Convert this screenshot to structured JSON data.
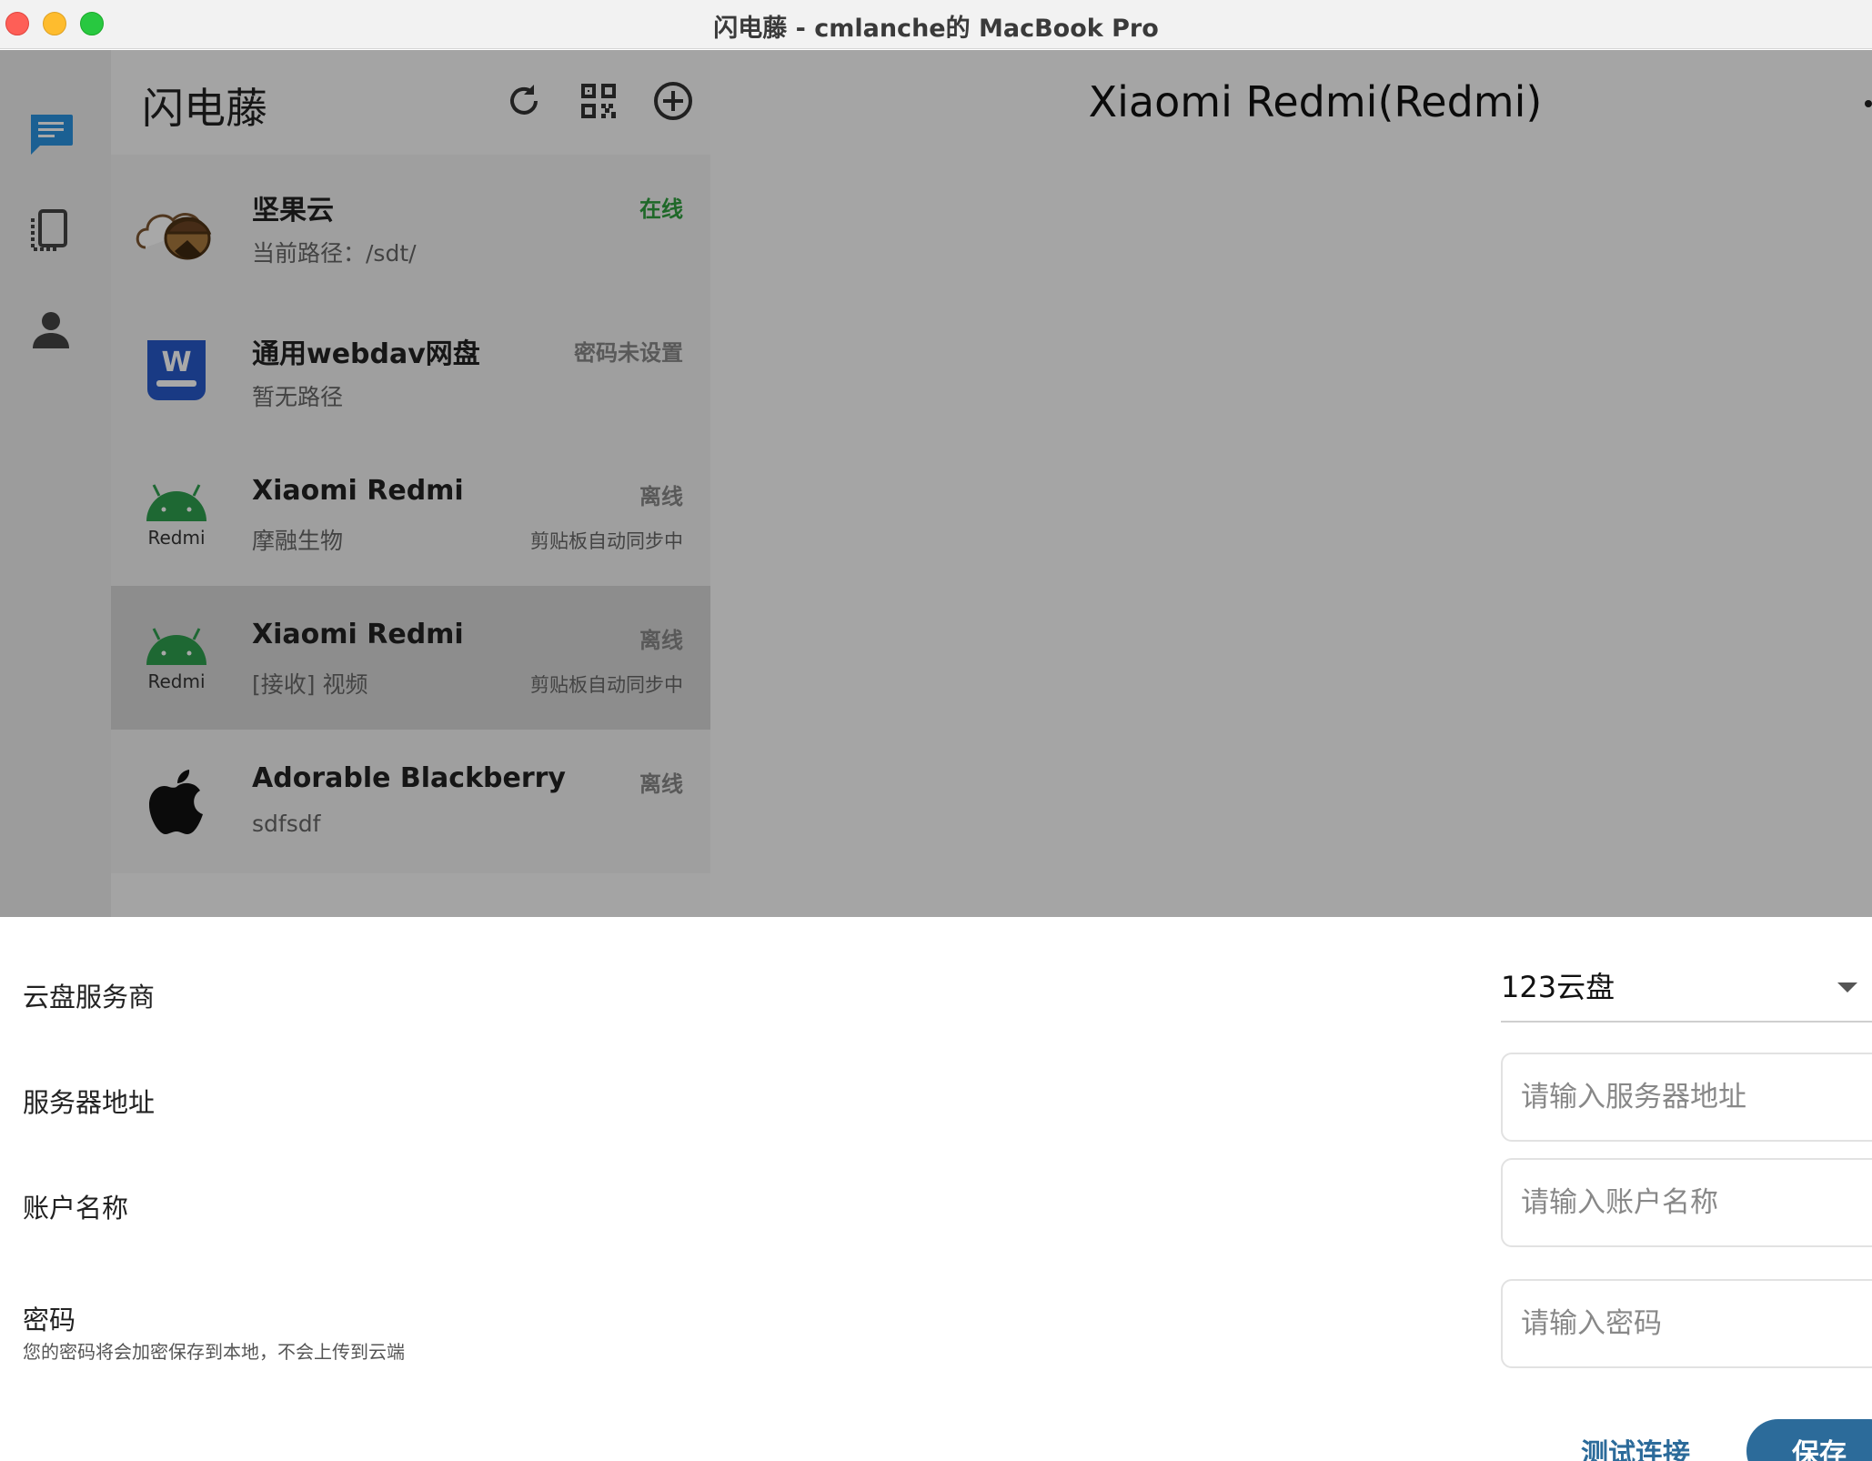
{
  "window": {
    "title": "闪电藤 - cmlanche的 MacBook Pro"
  },
  "rail": {
    "icons": [
      "chat-icon",
      "devices-icon",
      "person-icon"
    ]
  },
  "header": {
    "app_name": "闪电藤",
    "buttons": [
      "refresh-icon",
      "qrcode-icon",
      "add-icon"
    ]
  },
  "devices": [
    {
      "name": "坚果云",
      "desc": "当前路径：/sdt/",
      "status": "在线",
      "status_kind": "online",
      "icon": "jianguoyun-logo-icon",
      "icon_sub": "",
      "sync": ""
    },
    {
      "name": "通用webdav网盘",
      "desc": "暂无路径",
      "status": "密码未设置",
      "status_kind": "neutral",
      "icon": "webdav-logo-icon",
      "icon_sub": "",
      "sync": ""
    },
    {
      "name": "Xiaomi Redmi",
      "desc": "摩融生物",
      "status": "离线",
      "status_kind": "offline",
      "icon": "android-icon",
      "icon_sub": "Redmi",
      "sync": "剪贴板自动同步中"
    },
    {
      "name": "Xiaomi Redmi",
      "desc": "[接收] 视频",
      "status": "离线",
      "status_kind": "offline",
      "icon": "android-icon",
      "icon_sub": "Redmi",
      "sync": "剪贴板自动同步中",
      "selected": true
    },
    {
      "name": "Adorable Blackberry",
      "desc": "sdfsdf",
      "status": "离线",
      "status_kind": "offline",
      "icon": "apple-icon",
      "icon_sub": "",
      "sync": ""
    }
  ],
  "detail": {
    "title": "Xiaomi Redmi(Redmi)"
  },
  "sheet": {
    "provider_label": "云盘服务商",
    "provider_value": "123云盘",
    "server_label": "服务器地址",
    "server_placeholder": "请输入服务器地址",
    "account_label": "账户名称",
    "account_placeholder": "请输入账户名称",
    "password_label": "密码",
    "password_hint": "您的密码将会加密保存到本地，不会上传到云端",
    "password_placeholder": "请输入密码",
    "test_button": "测试连接",
    "save_button": "保存"
  },
  "colors": {
    "accent": "#2c6b9a",
    "online": "#2e9e3e",
    "android": "#2e9e4e"
  }
}
